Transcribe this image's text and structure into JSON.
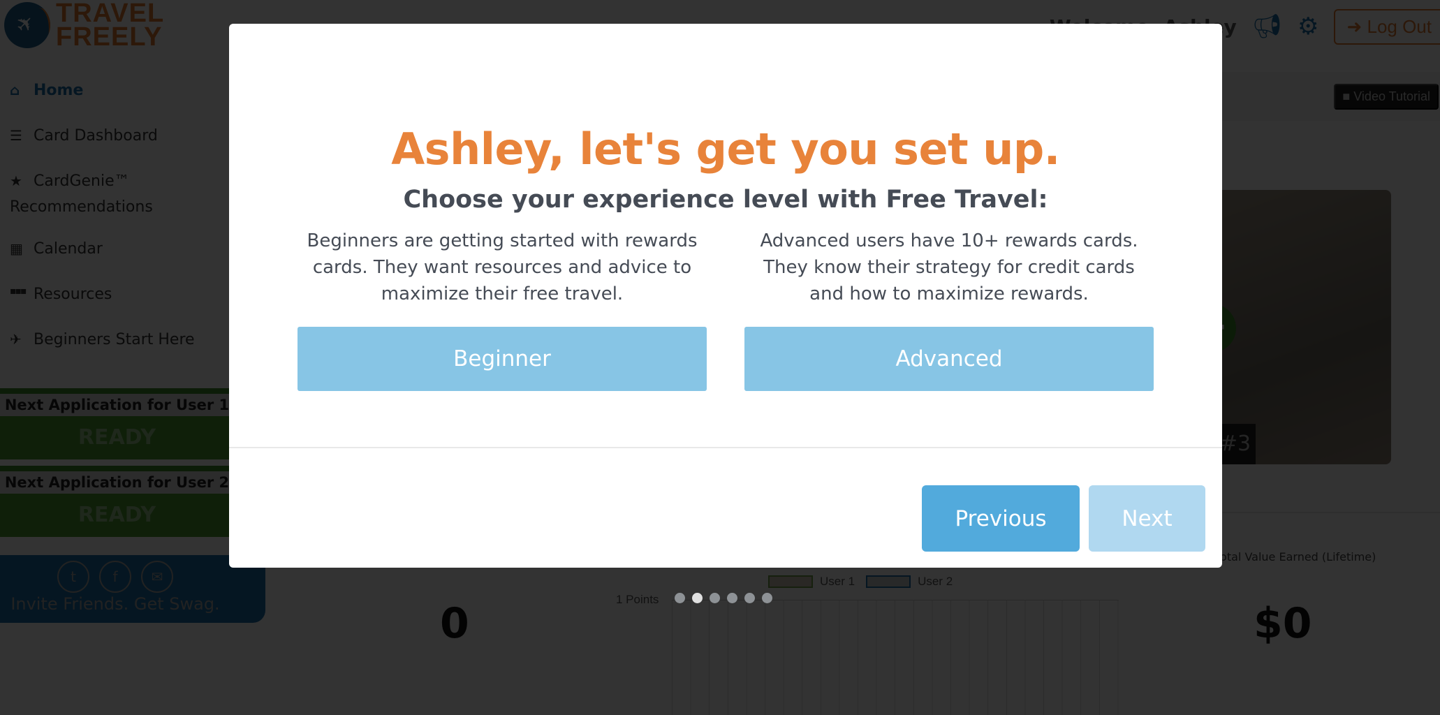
{
  "brand": {
    "line1": "TRAVEL",
    "line2": "FREELY",
    "logo_icon": "plane-globe-icon"
  },
  "header": {
    "welcome": "Welcome, Ashley",
    "announcements_icon": "megaphone-icon",
    "settings_icon": "gear-icon",
    "logout_label": "Log Out",
    "logout_icon": "sign-out-icon"
  },
  "sidebar": {
    "items": [
      {
        "label": "Home",
        "icon": "home-icon",
        "glyph": "⌂",
        "active": true
      },
      {
        "label": "Card Dashboard",
        "icon": "list-icon",
        "glyph": "☰"
      },
      {
        "label": "CardGenie™",
        "label2": "Recommendations",
        "icon": "star-icon",
        "glyph": "★"
      },
      {
        "label": "Calendar",
        "icon": "calendar-icon",
        "glyph": "▦"
      },
      {
        "label": "Resources",
        "icon": "grid-icon",
        "glyph": "⋮⋮⋮"
      },
      {
        "label": "Beginners Start Here",
        "icon": "plane-icon",
        "glyph": "✈"
      }
    ],
    "next_applications": [
      {
        "title": "Next Application for User 1",
        "status": "READY"
      },
      {
        "title": "Next Application for User 2",
        "status": "READY"
      }
    ],
    "invite": {
      "text": "Invite Friends. Get Swag.",
      "social": [
        {
          "icon": "twitter-icon",
          "glyph": "🐦︎"
        },
        {
          "icon": "facebook-icon",
          "glyph": "f"
        },
        {
          "icon": "email-icon",
          "glyph": "✉"
        }
      ]
    }
  },
  "main": {
    "video_tutorial_label": "Video Tutorial",
    "video_icon": "video-camera-icon",
    "card_rank": "#3",
    "add_card_glyph": "+",
    "points_value": "0",
    "chart": {
      "y_label": "1 Points",
      "legend": [
        "User 1",
        "User 2"
      ]
    },
    "total_value_label": "Total Value Earned (Lifetime)",
    "total_value": "$0"
  },
  "modal": {
    "title": "Ashley, let's get you set up.",
    "subtitle": "Choose your experience level with Free Travel:",
    "options": [
      {
        "description": "Beginners are getting started with rewards cards. They want resources and advice to maximize their free travel.",
        "button": "Beginner"
      },
      {
        "description": "Advanced users have 10+ rewards cards. They know their strategy for credit cards and how to maximize rewards.",
        "button": "Advanced"
      }
    ],
    "previous_label": "Previous",
    "next_label": "Next",
    "steps": {
      "total": 6,
      "current": 2
    }
  },
  "colors": {
    "brand_orange": "#e8833a",
    "brand_blue": "#1b6fa8",
    "option_button": "#87c5e5",
    "previous_button": "#52aadc",
    "next_button_disabled": "#b0d8f0",
    "ready_green": "#4a9a2e",
    "heading_text": "#454b55"
  }
}
